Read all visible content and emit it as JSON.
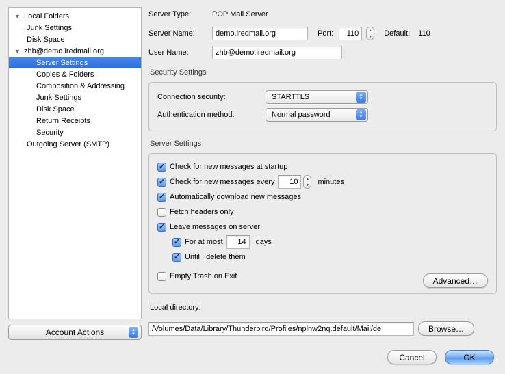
{
  "sidebar": {
    "items": [
      {
        "label": "Local Folders",
        "expandable": true,
        "level": 0
      },
      {
        "label": "Junk Settings",
        "level": 1
      },
      {
        "label": "Disk Space",
        "level": 1
      },
      {
        "label": "zhb@demo.iredmail.org",
        "expandable": true,
        "level": 0
      },
      {
        "label": "Server Settings",
        "level": 2,
        "selected": true
      },
      {
        "label": "Copies & Folders",
        "level": 2
      },
      {
        "label": "Composition & Addressing",
        "level": 2
      },
      {
        "label": "Junk Settings",
        "level": 2
      },
      {
        "label": "Disk Space",
        "level": 2
      },
      {
        "label": "Return Receipts",
        "level": 2
      },
      {
        "label": "Security",
        "level": 2
      },
      {
        "label": "Outgoing Server (SMTP)",
        "level": 1
      }
    ],
    "account_actions_label": "Account Actions"
  },
  "header": {
    "server_type_label": "Server Type:",
    "server_type_value": "POP Mail Server",
    "server_name_label": "Server Name:",
    "server_name_value": "demo.iredmail.org",
    "port_label": "Port:",
    "port_value": "110",
    "default_label": "Default:",
    "default_value": "110",
    "user_name_label": "User Name:",
    "user_name_value": "zhb@demo.iredmail.org"
  },
  "security": {
    "legend": "Security Settings",
    "connection_label": "Connection security:",
    "connection_value": "STARTTLS",
    "auth_label": "Authentication method:",
    "auth_value": "Normal password"
  },
  "server": {
    "legend": "Server Settings",
    "check_startup": "Check for new messages at startup",
    "check_every_prefix": "Check for new messages every",
    "check_every_value": "10",
    "check_every_suffix": "minutes",
    "auto_download": "Automatically download new messages",
    "fetch_headers": "Fetch headers only",
    "leave_on_server": "Leave messages on server",
    "for_at_most_prefix": "For at most",
    "for_at_most_value": "14",
    "for_at_most_suffix": "days",
    "until_delete": "Until I delete them",
    "empty_trash": "Empty Trash on Exit",
    "advanced_label": "Advanced…"
  },
  "local_dir": {
    "label": "Local directory:",
    "value": "/Volumes/Data/Library/Thunderbird/Profiles/nplnw2nq.default/Mail/de",
    "browse_label": "Browse…"
  },
  "buttons": {
    "cancel": "Cancel",
    "ok": "OK"
  }
}
